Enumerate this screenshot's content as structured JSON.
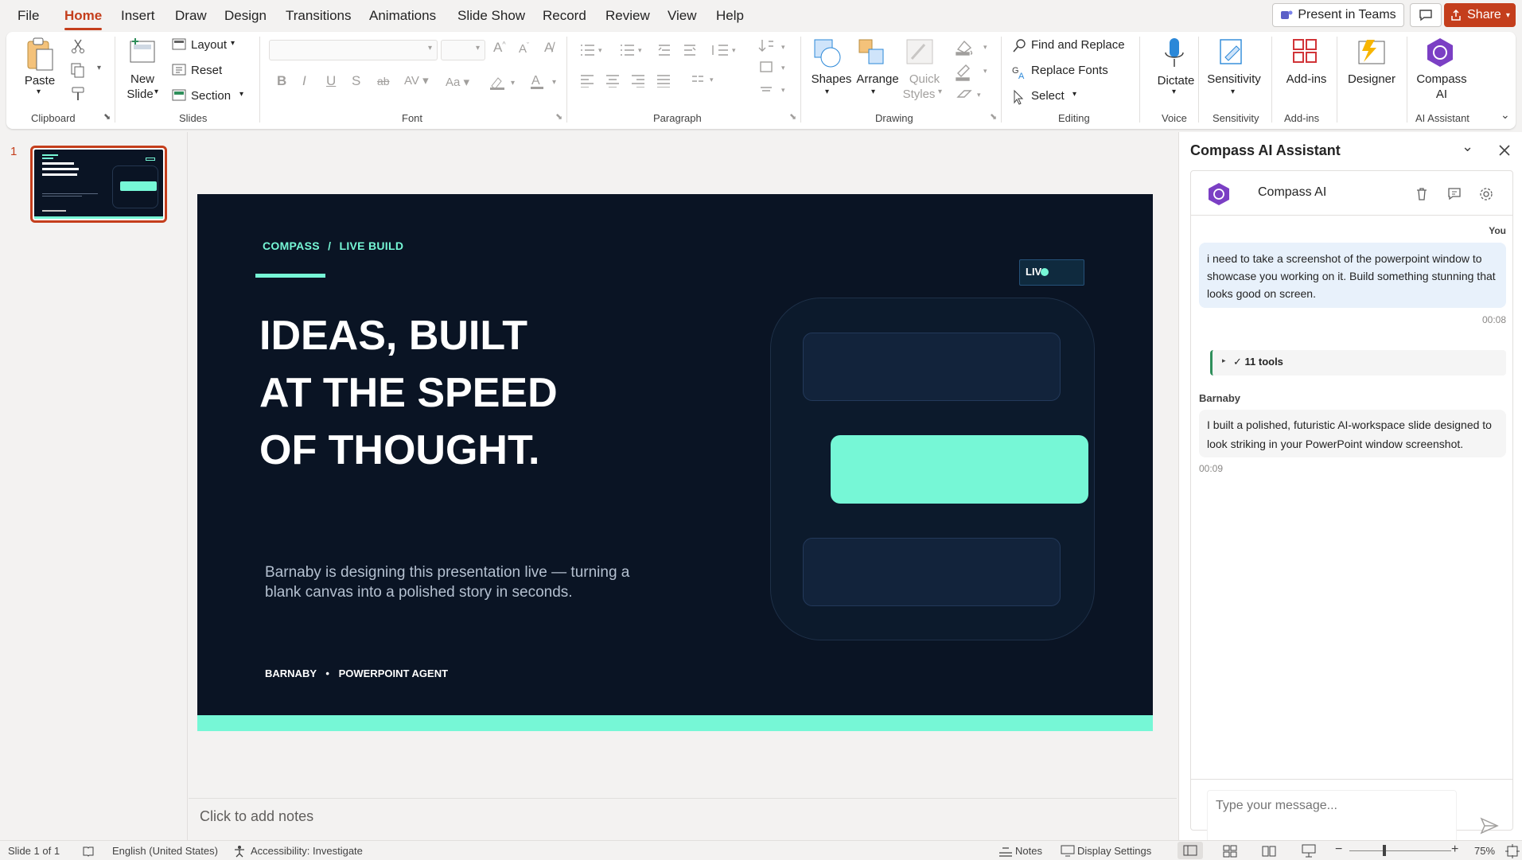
{
  "menu": {
    "tabs": [
      "File",
      "Home",
      "Insert",
      "Draw",
      "Design",
      "Transitions",
      "Animations",
      "Slide Show",
      "Record",
      "Review",
      "View",
      "Help"
    ],
    "active": "Home",
    "present_teams": "Present in Teams",
    "share": "Share"
  },
  "ribbon": {
    "clipboard": {
      "paste": "Paste",
      "label": "Clipboard"
    },
    "slides": {
      "new_slide_1": "New",
      "new_slide_2": "Slide",
      "layout": "Layout",
      "reset": "Reset",
      "section": "Section",
      "label": "Slides"
    },
    "font": {
      "label": "Font",
      "font_name": "",
      "font_size": ""
    },
    "paragraph": {
      "label": "Paragraph"
    },
    "drawing": {
      "shapes": "Shapes",
      "arrange": "Arrange",
      "quick_styles_1": "Quick",
      "quick_styles_2": "Styles",
      "label": "Drawing"
    },
    "editing": {
      "find_replace": "Find and Replace",
      "replace_fonts": "Replace Fonts",
      "select": "Select",
      "label": "Editing"
    },
    "voice": {
      "dictate": "Dictate",
      "label": "Voice"
    },
    "sensitivity": {
      "sensitivity": "Sensitivity",
      "label": "Sensitivity"
    },
    "addins": {
      "addins": "Add-ins",
      "label": "Add-ins"
    },
    "designer": {
      "designer": "Designer"
    },
    "ai": {
      "compass_1": "Compass",
      "compass_2": "AI",
      "label": "AI Assistant"
    }
  },
  "thumbnails": {
    "slide_number": "1"
  },
  "slide": {
    "kicker_left": "COMPASS",
    "kicker_sep": "/",
    "kicker_right": "LIVE BUILD",
    "title_lines": [
      "IDEAS, BUILT",
      "AT THE SPEED",
      "OF THOUGHT."
    ],
    "subtitle_1": "Barnaby is designing this presentation live — turning a",
    "subtitle_2": "blank canvas into a polished story in seconds.",
    "footer_left": "BARNABY",
    "footer_right": "POWERPOINT AGENT",
    "live_badge": "LIV",
    "colors": {
      "bg": "#0a1424",
      "accent": "#76f7d6",
      "card": "#13233a",
      "panel": "#0f1d30"
    }
  },
  "notes": {
    "placeholder": "Click to add notes"
  },
  "assistant": {
    "pane_title": "Compass AI Assistant",
    "header_name": "Compass AI",
    "user_label": "You",
    "user_message": "i need to take a screenshot of the powerpoint window to showcase you working on it. Build something stunning that looks good on screen.",
    "user_time": "00:08",
    "tools": "✓ 11 tools",
    "agent_name": "Barnaby",
    "agent_message": "I built a polished, futuristic AI-workspace slide designed to look striking in your PowerPoint window screenshot.",
    "agent_time": "00:09",
    "input_placeholder": "Type your message..."
  },
  "status": {
    "slide_count": "Slide 1 of 1",
    "language": "English (United States)",
    "accessibility": "Accessibility: Investigate",
    "notes": "Notes",
    "display": "Display Settings",
    "zoom": "75%"
  }
}
